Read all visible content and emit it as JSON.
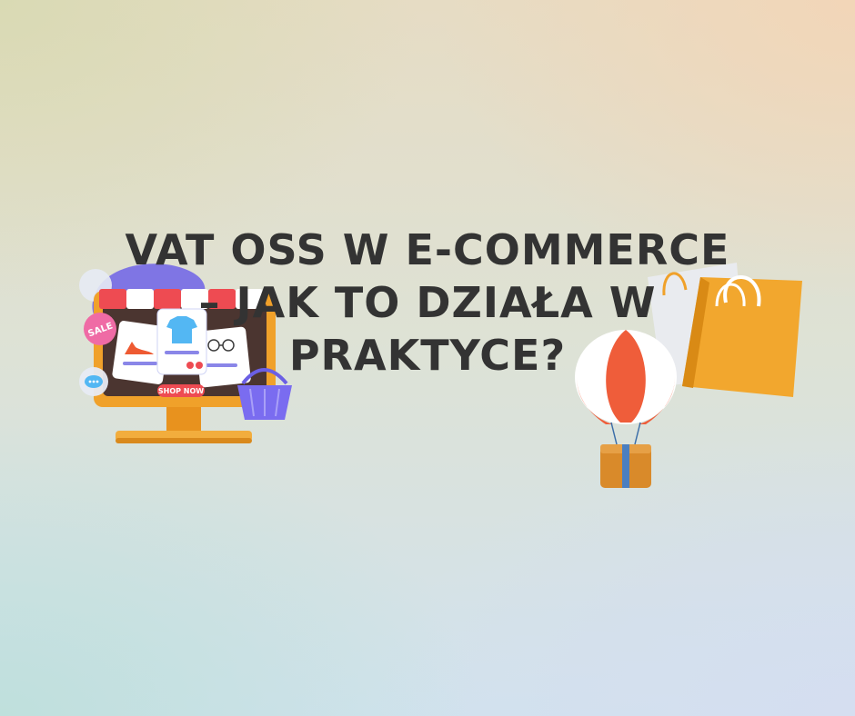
{
  "title": {
    "line1": "VAT OSS W E-COMMERCE",
    "line2": "– JAK TO DZIAŁA W",
    "line3": "PRAKTYCE?"
  },
  "shop_illustration": {
    "sale_badge": "SALE",
    "shop_now_button": "SHOP NOW",
    "icons": [
      "monitor-icon",
      "shop-awning-icon",
      "shoe-icon",
      "tshirt-icon",
      "glasses-icon",
      "shopping-basket-icon",
      "chat-bubble-icon"
    ]
  },
  "delivery_illustration": {
    "icons": [
      "hot-air-balloon-icon",
      "parcel-box-icon",
      "shopping-bag-icon"
    ]
  },
  "colors": {
    "title_text": "#333333",
    "accent_orange": "#f0a12a",
    "accent_red": "#ee4b52",
    "accent_purple": "#7a6cf0"
  }
}
